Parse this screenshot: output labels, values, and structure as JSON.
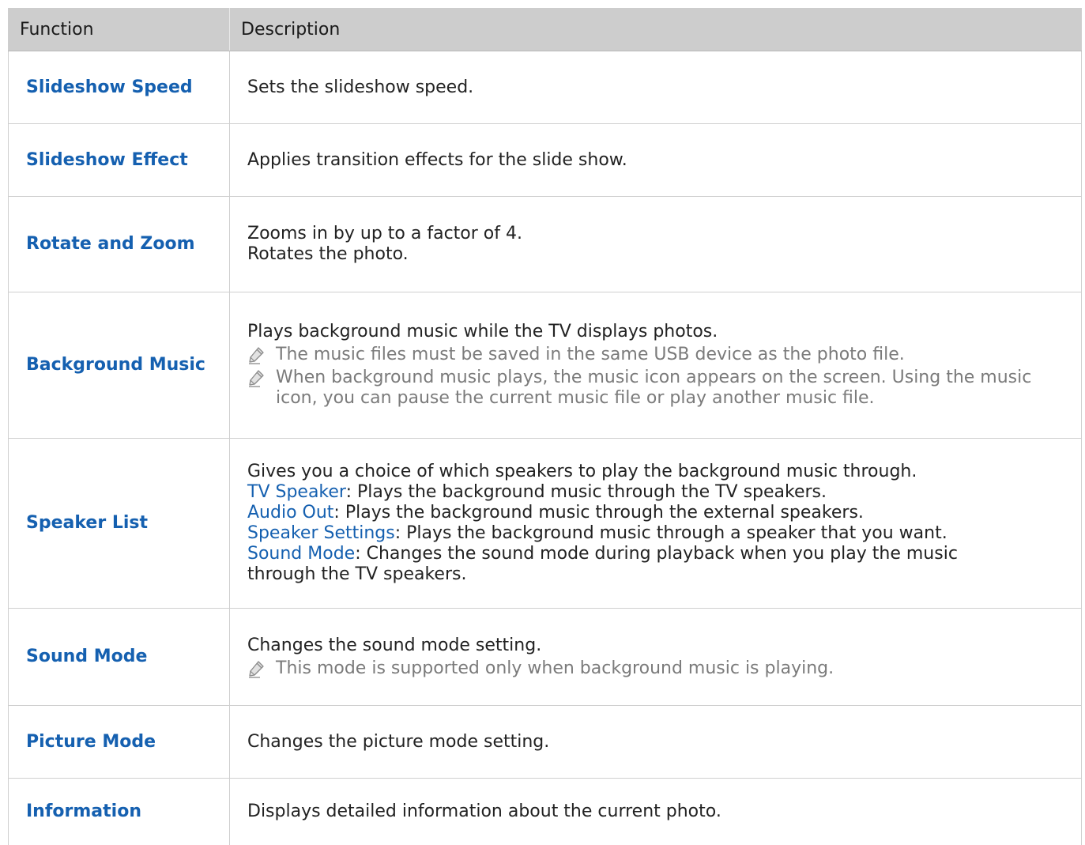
{
  "table": {
    "header": {
      "function": "Function",
      "description": "Description"
    },
    "rows": [
      {
        "function": "Slideshow Speed",
        "lines": [
          "Sets the slideshow speed."
        ]
      },
      {
        "function": "Slideshow Effect",
        "lines": [
          "Applies transition effects for the slide show."
        ]
      },
      {
        "function": "Rotate and Zoom",
        "lines": [
          "Zooms in by up to a factor of 4.",
          "Rotates the photo."
        ]
      },
      {
        "function": "Background Music",
        "lines": [
          "Plays background music while the TV displays photos."
        ],
        "notes": [
          "The music files must be saved in the same USB device as the photo file.",
          "When background music plays, the music icon appears on the screen. Using the music icon, you can pause the current music file or play another music file."
        ]
      },
      {
        "function": "Speaker List",
        "lines": [
          "Gives you a choice of which speakers to play the background music through."
        ],
        "options": [
          {
            "name": "TV Speaker",
            "text": ": Plays the background music through the TV speakers."
          },
          {
            "name": "Audio Out",
            "text": ": Plays the background music through the external speakers."
          },
          {
            "name": "Speaker Settings",
            "text": ": Plays the background music through a speaker that you want."
          },
          {
            "name": "Sound Mode",
            "text": ": Changes the sound mode during playback when you play the music",
            "continuation": "through the TV speakers."
          }
        ]
      },
      {
        "function": "Sound Mode",
        "lines": [
          "Changes the sound mode setting."
        ],
        "notes": [
          "This mode is supported only when background music is playing."
        ]
      },
      {
        "function": "Picture Mode",
        "lines": [
          "Changes the picture mode setting."
        ]
      },
      {
        "function": "Information",
        "lines": [
          "Displays detailed information about the current photo."
        ]
      }
    ]
  },
  "note_icon": "pencil-note-icon",
  "colors": {
    "header_bg": "#cdcdcd",
    "function_text": "#1560b0",
    "note_text": "#7b7b7b",
    "border": "#cfcfcf"
  }
}
